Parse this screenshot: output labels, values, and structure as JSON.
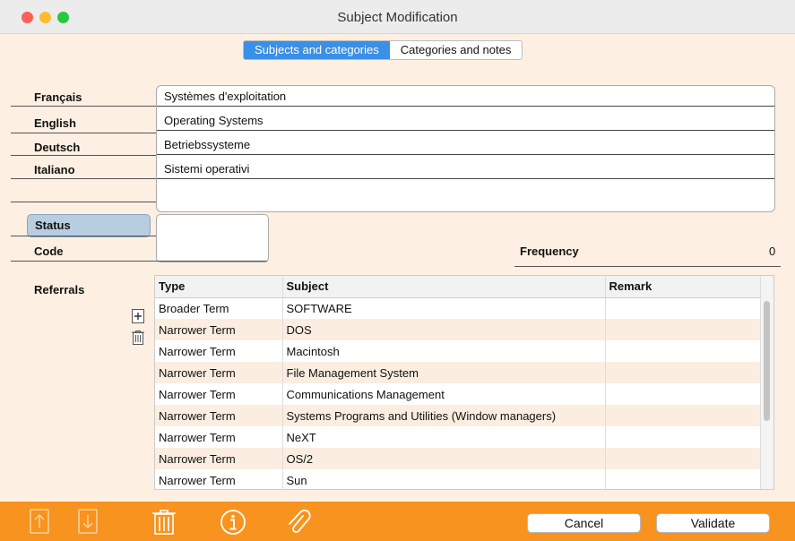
{
  "window": {
    "title": "Subject Modification"
  },
  "tabs": [
    {
      "label": "Subjects and categories",
      "active": true
    },
    {
      "label": "Categories and notes",
      "active": false
    }
  ],
  "languages": [
    {
      "label": "Français",
      "value": "Systèmes d'exploitation"
    },
    {
      "label": "English",
      "value": "Operating Systems"
    },
    {
      "label": "Deutsch",
      "value": "Betriebssysteme"
    },
    {
      "label": "Italiano",
      "value": "Sistemi operativi"
    }
  ],
  "status": {
    "label": "Status",
    "value": ""
  },
  "code": {
    "label": "Code",
    "value": ""
  },
  "frequency": {
    "label": "Frequency",
    "value": "0"
  },
  "referrals": {
    "label": "Referrals",
    "columns": [
      "Type",
      "Subject",
      "Remark"
    ],
    "rows": [
      {
        "type": "Broader Term",
        "subject": "SOFTWARE",
        "remark": ""
      },
      {
        "type": "Narrower Term",
        "subject": "DOS",
        "remark": ""
      },
      {
        "type": "Narrower Term",
        "subject": "Macintosh",
        "remark": ""
      },
      {
        "type": "Narrower Term",
        "subject": "File Management System",
        "remark": ""
      },
      {
        "type": "Narrower Term",
        "subject": "Communications Management",
        "remark": ""
      },
      {
        "type": "Narrower Term",
        "subject": "Systems Programs and Utilities (Window managers)",
        "remark": ""
      },
      {
        "type": "Narrower Term",
        "subject": "NeXT",
        "remark": ""
      },
      {
        "type": "Narrower Term",
        "subject": "OS/2",
        "remark": ""
      },
      {
        "type": "Narrower Term",
        "subject": "Sun",
        "remark": ""
      }
    ]
  },
  "buttons": {
    "cancel": "Cancel",
    "validate": "Validate"
  },
  "icons": {
    "side": [
      "add-icon",
      "trash-icon"
    ],
    "bottom": [
      "move-up-icon",
      "move-down-icon",
      "trash-icon",
      "info-icon",
      "paperclip-icon"
    ]
  },
  "colors": {
    "accent_tab": "#3a8fe6",
    "form_bg": "#fdf0e3",
    "toolbar_bg": "#f7931e",
    "status_bg": "#b8cde0"
  }
}
